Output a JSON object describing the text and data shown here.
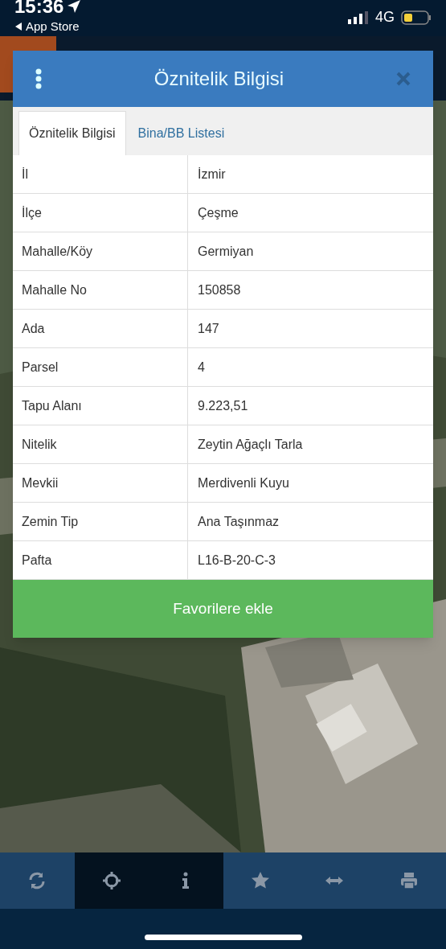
{
  "status_bar": {
    "time": "15:36",
    "back_link": "App Store",
    "network": "4G"
  },
  "dialog": {
    "title": "Öznitelik Bilgisi",
    "tabs": [
      {
        "label": "Öznitelik Bilgisi",
        "selected": true
      },
      {
        "label": "Bina/BB Listesi",
        "selected": false
      }
    ],
    "rows": [
      {
        "label": "İl",
        "value": "İzmir"
      },
      {
        "label": "İlçe",
        "value": "Çeşme"
      },
      {
        "label": "Mahalle/Köy",
        "value": "Germiyan"
      },
      {
        "label": "Mahalle No",
        "value": "150858"
      },
      {
        "label": "Ada",
        "value": "147"
      },
      {
        "label": "Parsel",
        "value": "4"
      },
      {
        "label": "Tapu Alanı",
        "value": "9.223,51"
      },
      {
        "label": "Nitelik",
        "value": "Zeytin Ağaçlı Tarla"
      },
      {
        "label": "Mevkii",
        "value": "Merdivenli Kuyu"
      },
      {
        "label": "Zemin Tip",
        "value": "Ana Taşınmaz"
      },
      {
        "label": "Pafta",
        "value": "L16-B-20-C-3"
      }
    ],
    "button": "Favorilere ekle"
  },
  "toolbar": [
    {
      "kind": "refresh",
      "selected": false
    },
    {
      "kind": "locate",
      "selected": true
    },
    {
      "kind": "info",
      "selected": true
    },
    {
      "kind": "star",
      "selected": false
    },
    {
      "kind": "arrows",
      "selected": false
    },
    {
      "kind": "print",
      "selected": false
    }
  ]
}
